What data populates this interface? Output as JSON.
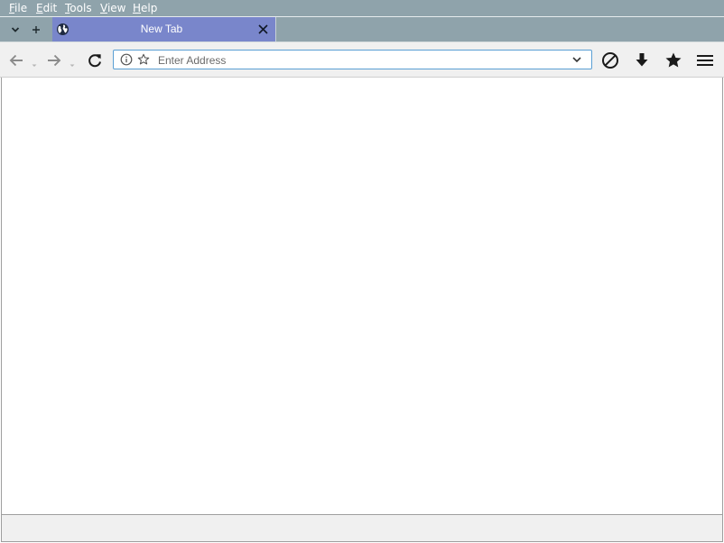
{
  "menubar": {
    "items": [
      {
        "mnemonic": "F",
        "rest": "ile"
      },
      {
        "mnemonic": "E",
        "rest": "dit"
      },
      {
        "mnemonic": "T",
        "rest": "ools"
      },
      {
        "mnemonic": "V",
        "rest": "iew"
      },
      {
        "mnemonic": "H",
        "rest": "elp"
      }
    ]
  },
  "tabbar": {
    "list_tabs_icon": "chevron-down-icon",
    "new_tab_icon": "plus-icon",
    "tabs": [
      {
        "title": "New Tab",
        "icon": "globe-icon",
        "close_icon": "close-icon",
        "active": true
      }
    ]
  },
  "toolbar": {
    "back_icon": "arrow-left-icon",
    "forward_icon": "arrow-right-icon",
    "reload_icon": "reload-icon",
    "urlbar": {
      "placeholder": "Enter Address",
      "value": "",
      "info_icon": "info-icon",
      "bookmark_icon": "star-outline-icon",
      "dropdown_icon": "chevron-down-icon"
    },
    "block_icon": "block-icon",
    "downloads_icon": "download-icon",
    "bookmarks_icon": "star-icon",
    "menu_icon": "hamburger-icon"
  },
  "statusbar": {
    "text": ""
  },
  "colors": {
    "chrome": "#8fa3ab",
    "active_tab": "#7986cb",
    "toolbar": "#f0f0f0",
    "url_border": "#5a9fd4"
  }
}
